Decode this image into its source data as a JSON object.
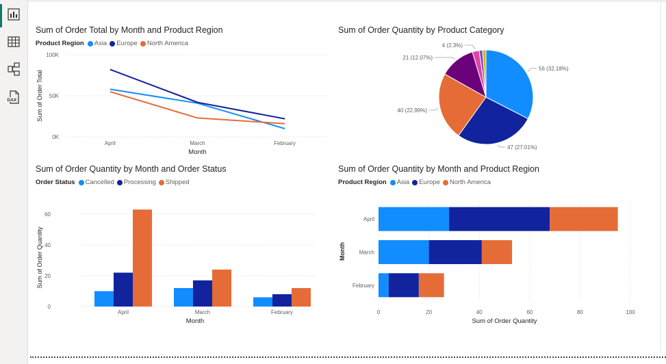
{
  "sidebar": {
    "items": [
      {
        "name": "report-view",
        "icon": "bar-chart-icon"
      },
      {
        "name": "table-view",
        "icon": "table-grid-icon"
      },
      {
        "name": "model-view",
        "icon": "model-diagram-icon"
      },
      {
        "name": "dax-query-view",
        "icon": "dax-file-icon",
        "label": "DAX"
      }
    ],
    "active_color": "#117865"
  },
  "colors": {
    "asia": "#118DFF",
    "europe": "#12239E",
    "north_america": "#E66C37",
    "purple": "#6B007B",
    "magenta": "#E044A7",
    "violet": "#744EC2",
    "gold": "#D9B300"
  },
  "charts": {
    "line": {
      "title": "Sum of Order Total by Month and Product Region",
      "legend_title": "Product Region",
      "legend": [
        "Asia",
        "Europe",
        "North America"
      ],
      "ylabel": "Sum of Order Total",
      "xlabel": "Month",
      "yticks": [
        "100K",
        "50K",
        "0K"
      ]
    },
    "pie": {
      "title": "Sum of Order Quantity by Product Category",
      "labels": [
        "56 (32.18%)",
        "47 (27.01%)",
        "40 (22.99%)",
        "21 (12.07%)",
        "4 (2.3%)"
      ]
    },
    "column": {
      "title": "Sum of Order Quantity by Month and Order Status",
      "legend_title": "Order Status",
      "legend": [
        "Cancelled",
        "Processing",
        "Shipped"
      ],
      "ylabel": "Sum of Order Quantity",
      "xlabel": "Month",
      "yticks": [
        "60",
        "40",
        "20",
        "0"
      ]
    },
    "bar": {
      "title": "Sum of Order Quantity by Month and Product Region",
      "legend_title": "Product Region",
      "legend": [
        "Asia",
        "Europe",
        "North America"
      ],
      "ylabel": "Month",
      "xlabel": "Sum of Order Quantity",
      "xticks": [
        "0",
        "20",
        "40",
        "60",
        "80",
        "100"
      ]
    }
  },
  "chart_data": [
    {
      "type": "line",
      "title": "Sum of Order Total by Month and Product Region",
      "xlabel": "Month",
      "ylabel": "Sum of Order Total",
      "categories": [
        "April",
        "March",
        "February"
      ],
      "ylim": [
        0,
        100000
      ],
      "series": [
        {
          "name": "Asia",
          "color": "#118DFF",
          "values": [
            58000,
            41000,
            10000
          ]
        },
        {
          "name": "Europe",
          "color": "#12239E",
          "values": [
            82000,
            42000,
            22000
          ]
        },
        {
          "name": "North America",
          "color": "#E66C37",
          "values": [
            55000,
            23000,
            16000
          ]
        }
      ],
      "grid": true,
      "legend_position": "top-left"
    },
    {
      "type": "pie",
      "title": "Sum of Order Quantity by Product Category",
      "slices": [
        {
          "value": 56,
          "percent": 32.18,
          "color": "#118DFF"
        },
        {
          "value": 47,
          "percent": 27.01,
          "color": "#12239E"
        },
        {
          "value": 40,
          "percent": 22.99,
          "color": "#E66C37"
        },
        {
          "value": 21,
          "percent": 12.07,
          "color": "#6B007B"
        },
        {
          "value": 4,
          "percent": 2.3,
          "color": "#E044A7"
        },
        {
          "value": 2,
          "color": "#744EC2"
        },
        {
          "value": 2,
          "color": "#D9B300"
        }
      ]
    },
    {
      "type": "bar",
      "orientation": "vertical",
      "title": "Sum of Order Quantity by Month and Order Status",
      "xlabel": "Month",
      "ylabel": "Sum of Order Quantity",
      "categories": [
        "April",
        "March",
        "February"
      ],
      "ylim": [
        0,
        68
      ],
      "series": [
        {
          "name": "Cancelled",
          "color": "#118DFF",
          "values": [
            10,
            12,
            6
          ]
        },
        {
          "name": "Processing",
          "color": "#12239E",
          "values": [
            22,
            17,
            8
          ]
        },
        {
          "name": "Shipped",
          "color": "#E66C37",
          "values": [
            63,
            24,
            12
          ]
        }
      ],
      "grid": true,
      "legend_position": "top-left"
    },
    {
      "type": "bar",
      "orientation": "horizontal",
      "stacked": true,
      "title": "Sum of Order Quantity by Month and Product Region",
      "xlabel": "Sum of Order Quantity",
      "ylabel": "Month",
      "categories": [
        "April",
        "March",
        "February"
      ],
      "xlim": [
        0,
        100
      ],
      "series": [
        {
          "name": "Asia",
          "color": "#118DFF",
          "values": [
            28,
            20,
            4
          ]
        },
        {
          "name": "Europe",
          "color": "#12239E",
          "values": [
            40,
            21,
            12
          ]
        },
        {
          "name": "North America",
          "color": "#E66C37",
          "values": [
            27,
            12,
            10
          ]
        }
      ],
      "grid": true,
      "legend_position": "top-left"
    }
  ]
}
